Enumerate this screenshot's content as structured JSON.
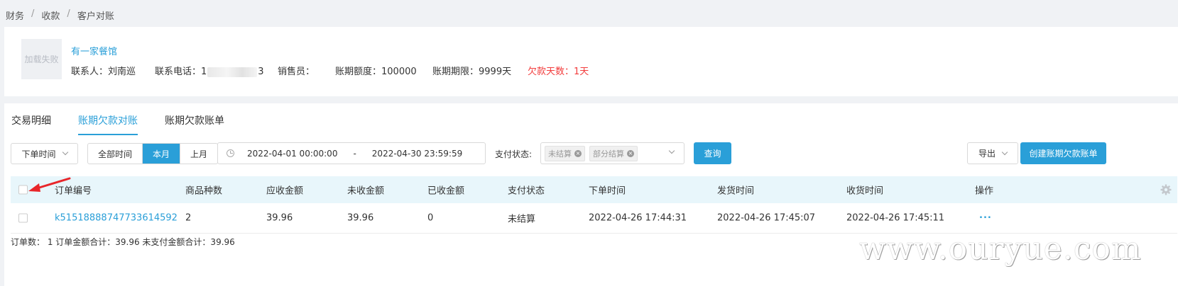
{
  "breadcrumb": [
    "财务",
    "收款",
    "客户对账"
  ],
  "customer": {
    "avatar_text": "加载失败",
    "name": "有一家餐馆",
    "contact_label": "联系人：",
    "contact_value": "刘南巡",
    "phone_label": "联系电话：",
    "phone_prefix": "1",
    "phone_suffix": "3",
    "salesperson_label": "销售员：",
    "salesperson_value": "",
    "credit_limit_label": "账期额度：",
    "credit_limit_value": "100000",
    "credit_term_label": "账期期限：",
    "credit_term_value": "9999天",
    "overdue_label": "欠款天数：",
    "overdue_value": "1天",
    "overdue_color": "#f23c3c"
  },
  "tabs": [
    {
      "label": "交易明细",
      "active": false
    },
    {
      "label": "账期欠款对账",
      "active": true
    },
    {
      "label": "账期欠款账单",
      "active": false
    }
  ],
  "filters": {
    "time_type": "下单时间",
    "range_buttons": [
      {
        "label": "全部时间",
        "active": false
      },
      {
        "label": "本月",
        "active": true
      },
      {
        "label": "上月",
        "active": false
      }
    ],
    "date_start": "2022-04-01 00:00:00",
    "date_separator": "-",
    "date_end": "2022-04-30 23:59:59",
    "pay_status_label": "支付状态:",
    "pay_status_tags": [
      "未结算",
      "部分结算"
    ],
    "query_button": "查询",
    "export_button": "导出",
    "create_button": "创建账期欠款账单"
  },
  "table": {
    "columns": [
      "订单编号",
      "商品种数",
      "应收金额",
      "未收金额",
      "已收金额",
      "支付状态",
      "下单时间",
      "发货时间",
      "收货时间",
      "操作"
    ],
    "rows": [
      {
        "order_no": "k51518888747733614592",
        "item_count": "2",
        "receivable": "39.96",
        "unpaid": "39.96",
        "paid": "0",
        "pay_status": "未结算",
        "order_time": "2022-04-26 17:44:31",
        "ship_time": "2022-04-26 17:45:07",
        "receive_time": "2022-04-26 17:45:11",
        "action": "···"
      }
    ]
  },
  "summary": "订单数：  1 订单金额合计：39.96 未支付金额合计：39.96",
  "watermark": "www.ouryue.com",
  "colors": {
    "accent": "#2a9fd8",
    "table_header_bg": "#e8f6fb",
    "annotation_arrow": "#e8262a"
  }
}
